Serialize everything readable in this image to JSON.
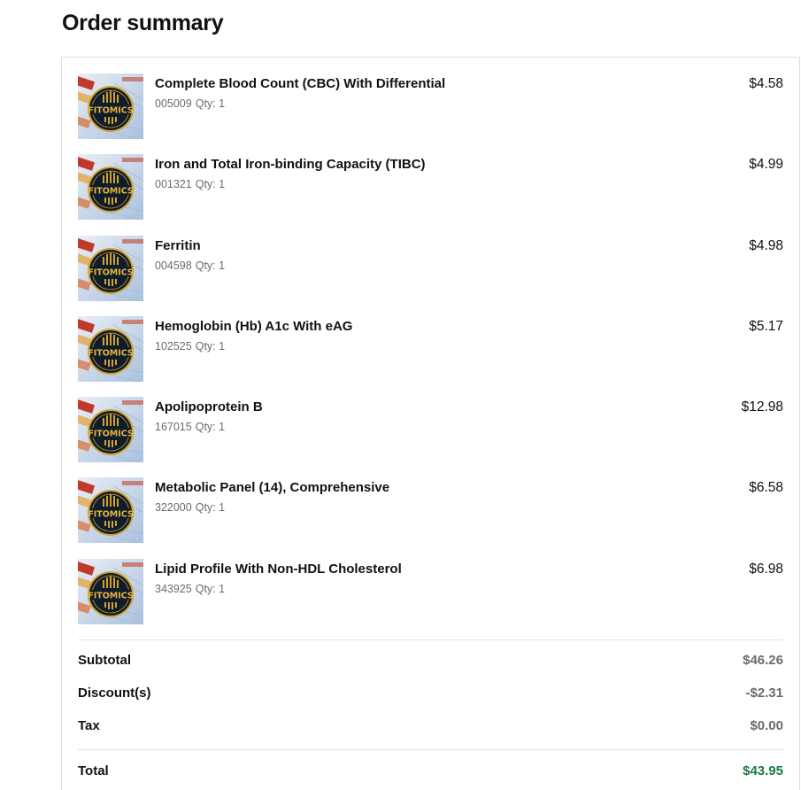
{
  "page": {
    "title": "Order summary"
  },
  "items": [
    {
      "name": "Complete Blood Count (CBC) With Differential",
      "code": "005009",
      "qty": "Qty: 1",
      "price": "$4.58",
      "thumb_text": "FITOMICS"
    },
    {
      "name": "Iron and Total Iron-binding Capacity (TIBC)",
      "code": "001321",
      "qty": "Qty: 1",
      "price": "$4.99",
      "thumb_text": "FITOMICS"
    },
    {
      "name": "Ferritin",
      "code": "004598",
      "qty": "Qty: 1",
      "price": "$4.98",
      "thumb_text": "FITOMICS"
    },
    {
      "name": "Hemoglobin (Hb) A1c With eAG",
      "code": "102525",
      "qty": "Qty: 1",
      "price": "$5.17",
      "thumb_text": "FITOMICS"
    },
    {
      "name": "Apolipoprotein B",
      "code": "167015",
      "qty": "Qty: 1",
      "price": "$12.98",
      "thumb_text": "FITOMICS"
    },
    {
      "name": "Metabolic Panel (14), Comprehensive",
      "code": "322000",
      "qty": "Qty: 1",
      "price": "$6.58",
      "thumb_text": "FITOMICS"
    },
    {
      "name": "Lipid Profile With Non-HDL Cholesterol",
      "code": "343925",
      "qty": "Qty: 1",
      "price": "$6.98",
      "thumb_text": "FITOMICS"
    }
  ],
  "summary": {
    "subtotal_label": "Subtotal",
    "subtotal_value": "$46.26",
    "discount_label": "Discount(s)",
    "discount_value": "-$2.31",
    "tax_label": "Tax",
    "tax_value": "$0.00",
    "total_label": "Total",
    "total_value": "$43.95"
  },
  "colors": {
    "total_green": "#1b7a47",
    "muted_gray": "#6b6b6b",
    "border": "#dedede"
  }
}
